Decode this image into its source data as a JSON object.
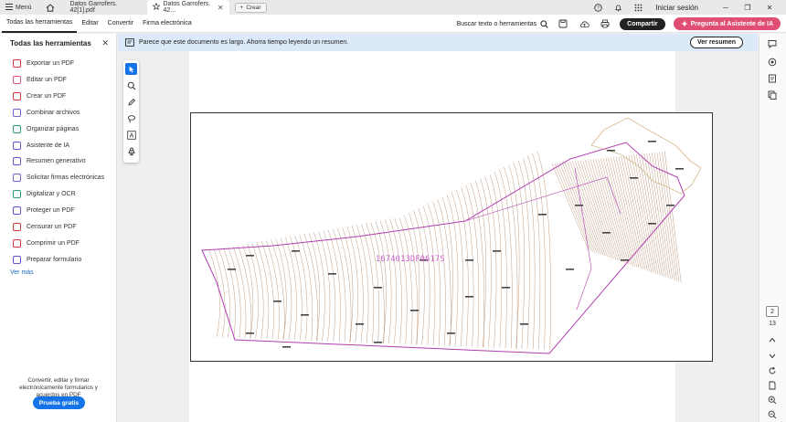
{
  "titlebar": {
    "menu_label": "Menú",
    "tabs": [
      {
        "label": "Datos Garrofers. 42[1].pdf",
        "active": false
      },
      {
        "label": "Datos Garrofers. 42...",
        "active": true
      }
    ],
    "new_tab_label": "Crear",
    "signin_label": "Iniciar sesión"
  },
  "menubar": {
    "items": [
      "Todas las herramientas",
      "Editar",
      "Convertir",
      "Firma electrónica"
    ],
    "active_index": 0,
    "search_label": "Buscar texto o herramientas",
    "share_label": "Compartir",
    "ai_label": "Pregunta al Asistente de IA"
  },
  "leftpanel": {
    "title": "Todas las herramientas",
    "tools": [
      {
        "label": "Exportar un PDF",
        "color": "#d7373f"
      },
      {
        "label": "Editar un PDF",
        "color": "#e0567a"
      },
      {
        "label": "Crear un PDF",
        "color": "#d7373f"
      },
      {
        "label": "Combinar archivos",
        "color": "#7b5ecf"
      },
      {
        "label": "Organizar páginas",
        "color": "#2d9d78"
      },
      {
        "label": "Asistente de IA",
        "color": "#6d4fd1"
      },
      {
        "label": "Resumen generativo",
        "color": "#6d4fd1"
      },
      {
        "label": "Solicitar firmas electrónicas",
        "color": "#7b5ecf"
      },
      {
        "label": "Digitalizar y OCR",
        "color": "#2d9d78"
      },
      {
        "label": "Proteger un PDF",
        "color": "#6d4fd1"
      },
      {
        "label": "Censurar un PDF",
        "color": "#d7373f"
      },
      {
        "label": "Comprimir un PDF",
        "color": "#d7373f"
      },
      {
        "label": "Preparar formulario",
        "color": "#6d4fd1"
      }
    ],
    "see_more": "Ver más",
    "promo_text": "Convertir, editar y firmar electrónicamente formularios y acuerdos en PDF",
    "try_label": "Prueba gratis"
  },
  "notification": {
    "text": "Parece que este documento es largo. Ahorra tiempo leyendo un resumen.",
    "button_label": "Ver resumen"
  },
  "document": {
    "reference_code": "1674013DF0617S"
  },
  "pagination": {
    "current_page": "2",
    "total_pages": "13"
  },
  "colors": {
    "accent_blue": "#1473e6",
    "ai_pink": "#e04e73",
    "boundary_magenta": "#b23db0",
    "contour_brown": "#a8734a"
  }
}
